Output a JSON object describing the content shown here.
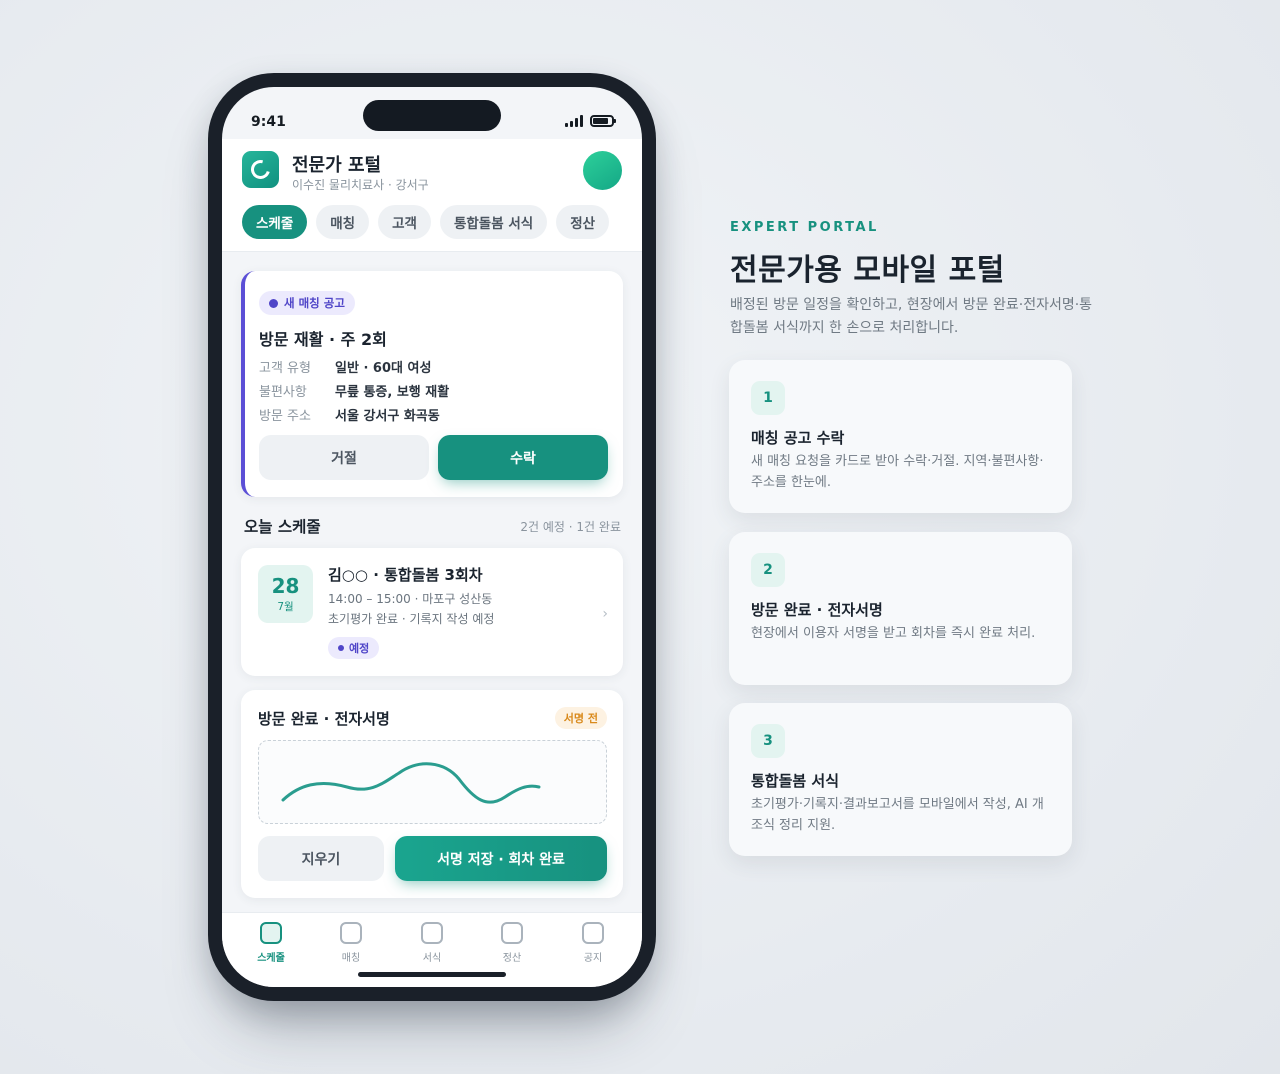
{
  "status_bar": {
    "time": "9:41"
  },
  "header": {
    "title": "전문가 포털",
    "subtitle": "이수진 물리치료사 · 강서구"
  },
  "tabs": [
    {
      "label": "스케줄",
      "active": true
    },
    {
      "label": "매칭",
      "active": false
    },
    {
      "label": "고객",
      "active": false
    },
    {
      "label": "통합돌봄 서식",
      "active": false
    },
    {
      "label": "정산",
      "active": false
    }
  ],
  "match_card": {
    "badge": "새 매칭 공고",
    "title": "방문 재활 · 주 2회",
    "rows": [
      {
        "key": "고객 유형",
        "value": "일반 · 60대 여성"
      },
      {
        "key": "불편사항",
        "value": "무릎 통증, 보행 재활"
      },
      {
        "key": "방문 주소",
        "value": "서울 강서구 화곡동"
      }
    ],
    "reject_label": "거절",
    "accept_label": "수락"
  },
  "today": {
    "heading": "오늘 스케줄",
    "meta": "2건 예정 · 1건 완료"
  },
  "schedule_item": {
    "day": "28",
    "month": "7월",
    "title": "김○○ · 통합돌봄 3회차",
    "time_place": "14:00 – 15:00 · 마포구 성산동",
    "note": "초기평가 완료 · 기록지 작성 예정",
    "status": "예정",
    "chevron": "›"
  },
  "sign_card": {
    "title": "방문 완료 · 전자서명",
    "status": "서명 전",
    "clear_label": "지우기",
    "save_label": "서명 저장 · 회차 완료"
  },
  "bottom_nav": [
    {
      "label": "스케줄",
      "active": true
    },
    {
      "label": "매칭",
      "active": false
    },
    {
      "label": "서식",
      "active": false
    },
    {
      "label": "정산",
      "active": false
    },
    {
      "label": "공지",
      "active": false
    }
  ],
  "panel": {
    "eyebrow": "EXPERT PORTAL",
    "headline": "전문가용 모바일 포털",
    "lead": "배정된 방문 일정을 확인하고, 현장에서 방문 완료·전자서명·통합돌봄 서식까지 한 손으로 처리합니다.",
    "features": [
      {
        "num": "1",
        "title": "매칭 공고 수락",
        "desc": "새 매칭 요청을 카드로 받아 수락·거절. 지역·불편사항·주소를 한눈에."
      },
      {
        "num": "2",
        "title": "방문 완료 · 전자서명",
        "desc": "현장에서 이용자 서명을 받고 회차를 즉시 완료 처리."
      },
      {
        "num": "3",
        "title": "통합돌봄 서식",
        "desc": "초기평가·기록지·결과보고서를 모바일에서 작성, AI 개조식 정리 지원."
      }
    ]
  },
  "colors": {
    "accent": "#17917f",
    "accent_soft": "#e3f4f0",
    "purple": "#4f45c8",
    "warning": "#d98a1c",
    "phone_frame": "#1a2029"
  },
  "icons": {
    "logo": "portal-logo-icon",
    "signal": "signal-icon",
    "battery": "battery-icon",
    "chevron": "chevron-right-icon"
  }
}
